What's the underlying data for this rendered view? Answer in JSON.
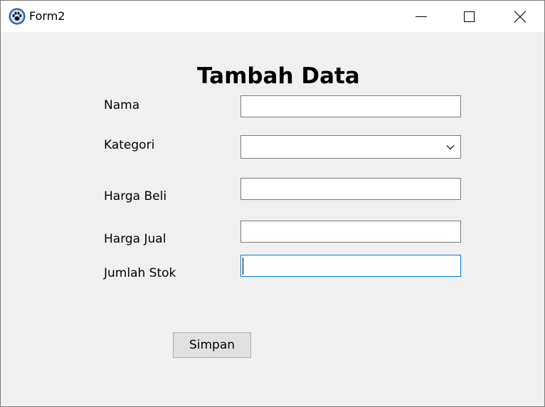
{
  "window": {
    "title": "Form2",
    "icon": "paw-icon"
  },
  "controls": {
    "minimize": "minimize-icon",
    "maximize": "maximize-icon",
    "close": "close-icon"
  },
  "form": {
    "heading": "Tambah Data",
    "fields": {
      "nama": {
        "label": "Nama",
        "value": ""
      },
      "kategori": {
        "label": "Kategori",
        "value": ""
      },
      "harga_beli": {
        "label": "Harga Beli",
        "value": ""
      },
      "harga_jual": {
        "label": "Harga Jual",
        "value": ""
      },
      "jumlah_stok": {
        "label": "Jumlah Stok",
        "value": ""
      }
    },
    "submit_label": "Simpan"
  },
  "colors": {
    "focus_border": "#0078d7",
    "window_bg": "#f0f0f0",
    "button_bg": "#e1e1e1"
  }
}
